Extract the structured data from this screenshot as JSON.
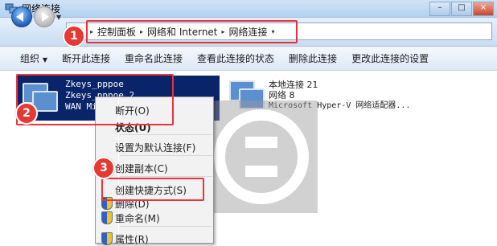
{
  "window": {
    "title": "网络连接"
  },
  "address_bar": {
    "breadcrumb": [
      "控制面板",
      "网络和 Internet",
      "网络连接"
    ]
  },
  "toolbar": {
    "items": [
      "组织",
      "断开此连接",
      "重命名此连接",
      "查看此连接的状态",
      "删除此连接",
      "更改此连接的设置"
    ]
  },
  "connections": [
    {
      "name": "Zkeys_pppoe",
      "status": "Zkeys_pppoe  2",
      "device": "WAN Mi"
    },
    {
      "name": "本地连接 21",
      "status": "网络  8",
      "device": "Microsoft Hyper-V 网络适配器..."
    }
  ],
  "context_menu": {
    "items": [
      "断开(O)",
      "状态(U)",
      "设置为默认连接(F)",
      "创建副本(C)",
      "创建快捷方式(S)",
      "删除(D)",
      "重命名(M)",
      "属性(R)"
    ]
  },
  "annotations": [
    "1",
    "2",
    "3"
  ],
  "colors": {
    "annotation_red": "#e53935",
    "selection": "#0a246a"
  }
}
